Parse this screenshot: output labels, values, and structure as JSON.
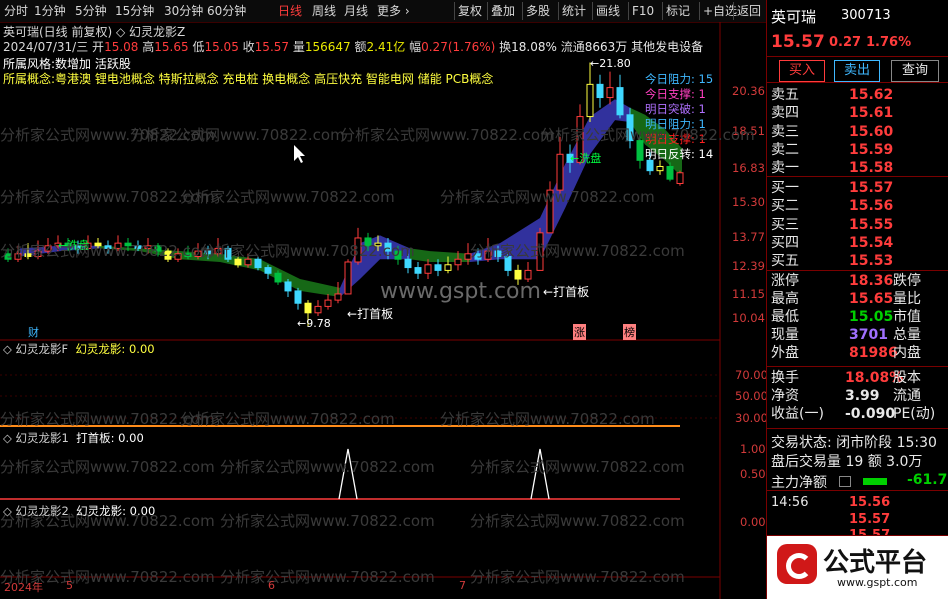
{
  "toolbar": {
    "left_items": [
      "分时",
      "1分钟",
      "5分钟",
      "15分钟",
      "30分钟",
      "60分钟",
      "日线",
      "周线",
      "月线",
      "更多 ›"
    ],
    "right_items": [
      "复权",
      "叠加",
      "多股",
      "统计",
      "画线",
      "F10",
      "标记",
      "+自选",
      "返回"
    ]
  },
  "chart": {
    "title_line": "英可瑞(日线 前复权) ◇ 幻灵龙影Z",
    "ohlc": {
      "date": "2024/07/31/三",
      "open_label": "开",
      "open": "15.08",
      "high_label": "高",
      "high": "15.65",
      "low_label": "低",
      "low": "15.05",
      "close_label": "收",
      "close": "15.57",
      "volume_label": "量",
      "volume": "156647",
      "amount_label": "额",
      "amount": "2.41亿",
      "range_label": "幅",
      "range": "0.27(1.76%)",
      "turnover_label": "换",
      "turnover": "18.08%",
      "float_label": "流通",
      "float": "8663万",
      "sector": "其他发电设备"
    },
    "style_line": "所属风格:数增加 活跃股",
    "concept_line": "所属概念:粤港澳 锂电池概念 特斯拉概念 充电桩 换电概念 高压快充 智能电网 储能 PCB概念",
    "legend": [
      {
        "label": "今日阻力:",
        "value": "15",
        "color": "#3fb8ff"
      },
      {
        "label": "今日支撑:",
        "value": "1",
        "color": "#ff40c0"
      },
      {
        "label": "明日突破:",
        "value": "1",
        "color": "#b070ff"
      },
      {
        "label": "明日阻力:",
        "value": "1",
        "color": "#3fb8ff"
      },
      {
        "label": "明日支撑:",
        "value": "1",
        "color": "#ff2020"
      },
      {
        "label": "明日反转:",
        "value": "14",
        "color": "#ffffff"
      }
    ],
    "annotations": {
      "peak": "21.80",
      "trough": "9.78",
      "xipan1": "洗盘",
      "xipan2": "洗盘",
      "dashouban1": "打首板",
      "dashouban2": "打首板",
      "cai": "财",
      "zhang": "涨",
      "bang": "榜"
    },
    "y_axis": [
      "20.36",
      "18.51",
      "16.83",
      "15.30",
      "13.77",
      "12.39",
      "11.15",
      "10.04"
    ],
    "x_axis": [
      "2024年",
      "5",
      "6",
      "7"
    ],
    "watermark_site": "www.gspt.com",
    "watermark_text": "分析家公式网www.70822.com"
  },
  "panels": [
    {
      "name": "幻灵龙影F",
      "line": "幻灵龙影: 0.00",
      "y": [
        "70.00",
        "50.00",
        "30.00"
      ]
    },
    {
      "name": "幻灵龙影1",
      "line": "打首板: 0.00",
      "y": [
        "1.00",
        "0.50"
      ]
    },
    {
      "name": "幻灵龙影2",
      "line": "幻灵龙影: 0.00",
      "y": [
        "0.00"
      ]
    }
  ],
  "quote": {
    "name": "英可瑞",
    "code": "300713",
    "price": "15.57",
    "change": "0.27",
    "pct": "1.76%",
    "buy_btn": "买入",
    "sell_btn": "卖出",
    "query_btn": "查询",
    "asks": [
      {
        "label": "卖五",
        "price": "15.62"
      },
      {
        "label": "卖四",
        "price": "15.61"
      },
      {
        "label": "卖三",
        "price": "15.60"
      },
      {
        "label": "卖二",
        "price": "15.59"
      },
      {
        "label": "卖一",
        "price": "15.58"
      }
    ],
    "bids": [
      {
        "label": "买一",
        "price": "15.57"
      },
      {
        "label": "买二",
        "price": "15.56"
      },
      {
        "label": "买三",
        "price": "15.55"
      },
      {
        "label": "买四",
        "price": "15.54"
      },
      {
        "label": "买五",
        "price": "15.53"
      }
    ],
    "stats": [
      {
        "label": "涨停",
        "value": "18.36",
        "label2": "跌停"
      },
      {
        "label": "最高",
        "value": "15.65",
        "label2": "量比"
      },
      {
        "label": "最低",
        "value": "15.05",
        "label2": "市值"
      },
      {
        "label": "现量",
        "value": "3701",
        "label2": "总量"
      },
      {
        "label": "外盘",
        "value": "81986",
        "label2": "内盘"
      }
    ],
    "stats2": [
      {
        "label": "换手",
        "value": "18.08%",
        "label2": "股本"
      },
      {
        "label": "净资",
        "value": "3.99",
        "label2": "流通"
      },
      {
        "label": "收益(一)",
        "value": "-0.090",
        "label2": "PE(动)"
      }
    ],
    "status": "交易状态: 闭市阶段 15:30",
    "after": "盘后交易量 19 额 3.0万",
    "net_label": "主力净额",
    "net_value": "-61.7",
    "ticks": [
      {
        "time": "14:56",
        "price": "15.56"
      },
      {
        "time": "",
        "price": "15.57"
      },
      {
        "time": "",
        "price": "15.57"
      }
    ],
    "brand": "公式平台",
    "brand_url": "www.gspt.com"
  }
}
